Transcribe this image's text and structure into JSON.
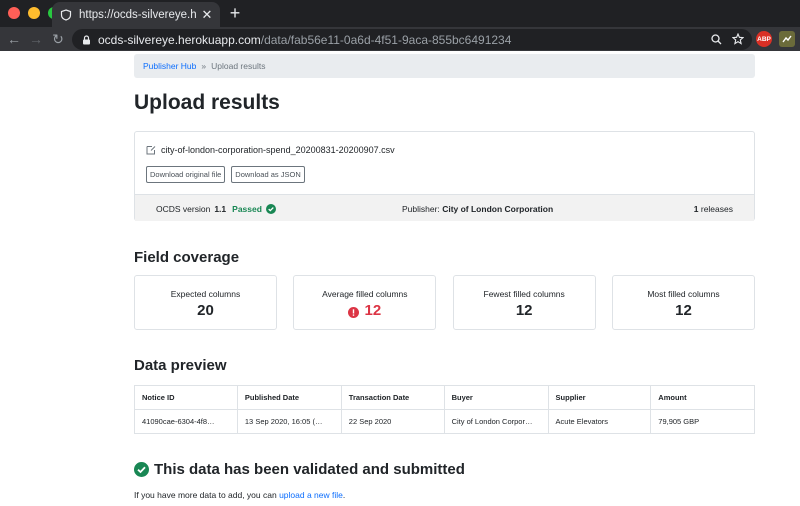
{
  "browser": {
    "tab_title": "https://ocds-silvereye.herokuap",
    "url_host": "ocds-silvereye.herokuapp.com",
    "url_path": "/data/fab56e11-0a6d-4f51-9aca-855bc6491234",
    "ext_abp": "ABP",
    "colors": {
      "close": "#ff5f57",
      "minimize": "#febc2e",
      "maximize": "#28c840"
    }
  },
  "breadcrumb": {
    "home": "Publisher Hub",
    "separator": "»",
    "current": "Upload results"
  },
  "page_title": "Upload results",
  "file": {
    "name": "city-of-london-corporation-spend_20200831-20200907.csv",
    "download_original": "Download original file",
    "download_json": "Download as JSON",
    "ocds_label": "OCDS version",
    "ocds_version": "1.1",
    "status": "Passed",
    "publisher_label": "Publisher:",
    "publisher": "City of London Corporation",
    "releases_count": "1",
    "releases_label": "releases"
  },
  "field_coverage": {
    "heading": "Field coverage",
    "cards": [
      {
        "label": "Expected columns",
        "value": "20"
      },
      {
        "label": "Average filled columns",
        "value": "12"
      },
      {
        "label": "Fewest filled columns",
        "value": "12"
      },
      {
        "label": "Most filled columns",
        "value": "12"
      }
    ]
  },
  "preview": {
    "heading": "Data preview",
    "columns": [
      "Notice ID",
      "Published Date",
      "Transaction Date",
      "Buyer",
      "Supplier",
      "Amount"
    ],
    "row": [
      "41090cae-6304-4f8…",
      "13 Sep 2020, 16:05 (…",
      "22 Sep 2020",
      "City of London Corpor…",
      "Acute Elevators",
      "79,905 GBP"
    ]
  },
  "validated": {
    "message": "This data has been validated and submitted",
    "more_prefix": "If you have more data to add, you can",
    "more_link": "upload a new file",
    "more_suffix": "."
  }
}
